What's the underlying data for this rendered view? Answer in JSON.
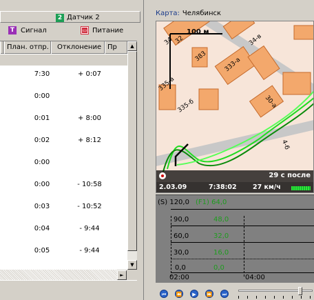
{
  "tabs": {
    "sensor2": "Датчик 2",
    "sensor2_num": "2",
    "signal": "Сигнал",
    "power": "Питание"
  },
  "table": {
    "columns": [
      "План. отпр.",
      "Отклонение",
      "Пр"
    ],
    "rows": [
      {
        "plan": "7:30",
        "dev": "+ 0:07"
      },
      {
        "plan": "0:00",
        "dev": ""
      },
      {
        "plan": "0:01",
        "dev": "+ 8:00"
      },
      {
        "plan": "0:02",
        "dev": "+ 8:12"
      },
      {
        "plan": "0:00",
        "dev": ""
      },
      {
        "plan": "0:00",
        "dev": "- 10:58"
      },
      {
        "plan": "0:03",
        "dev": "- 10:52"
      },
      {
        "plan": "0:04",
        "dev": "- 9:44"
      },
      {
        "plan": "0:05",
        "dev": "- 9:44"
      }
    ]
  },
  "map": {
    "label": "Карта:",
    "city": "Челябинск",
    "scale": "100 м",
    "buildings": [
      "383",
      "333-а",
      "335-а",
      "335-б",
      "30-а",
      "4-б",
      "34-в",
      "32",
      "34"
    ],
    "after": "29 с после",
    "date": "2.03.09",
    "time": "7:38:02",
    "speed": "27 км/ч"
  },
  "graph": {
    "header_s": "(S) 120,0",
    "header_f": "(F1) 64,0",
    "levels": [
      {
        "s": "90,0",
        "f": "48,0"
      },
      {
        "s": "60,0",
        "f": "32,0"
      },
      {
        "s": "30,0",
        "f": "16,0"
      },
      {
        "s": "0,0",
        "f": "0,0"
      }
    ],
    "t1": "02:00",
    "t2": "04:00"
  },
  "colors": {
    "map_bg": "#f7e5d9",
    "building": "#f3a86c",
    "road": "#c8c8c8",
    "track": "#1fdc1f",
    "f1_text": "#1e9c1e",
    "label_blue": "#1a3a8a"
  }
}
